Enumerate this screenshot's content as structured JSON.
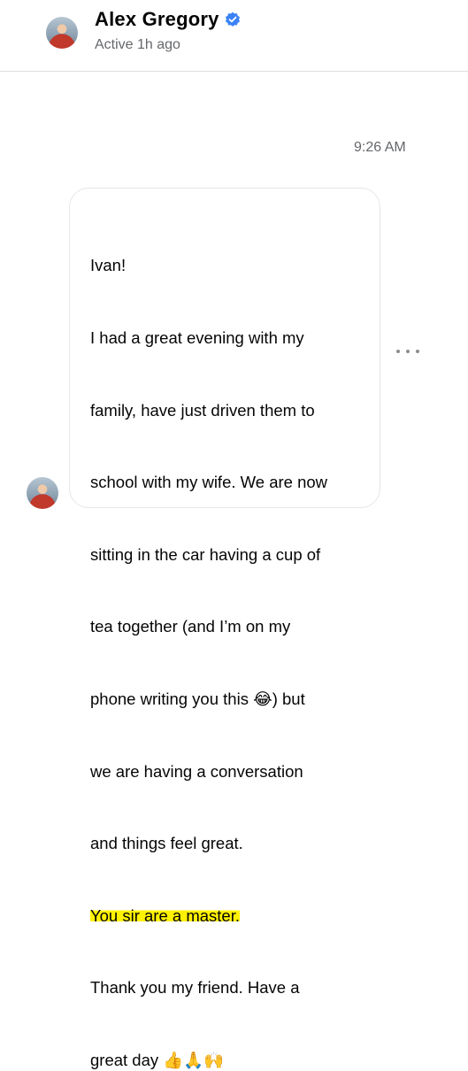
{
  "header": {
    "name": "Alex Gregory",
    "status": "Active 1h ago",
    "verified_color": "#3b82f6"
  },
  "conversation": {
    "timestamp": "9:26 AM",
    "message": {
      "lines": [
        "Ivan!",
        "I had a great evening with my",
        "family, have just driven them to",
        "school with my wife. We are now",
        "sitting in the car having a cup of",
        "tea together (and I’m on my",
        "phone writing you this",
        ") but",
        "we are having a conversation",
        "and things feel great.",
        "You sir are a master.",
        "Thank you my friend. Have a",
        "great day"
      ],
      "laugh_emoji": "😂",
      "end_emojis": "👍🙏🙌"
    },
    "highlight_color": "#fff200",
    "more_icon": "more-horizontal-icon"
  }
}
